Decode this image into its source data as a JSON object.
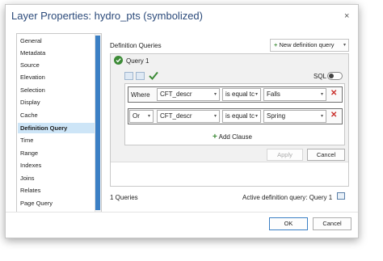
{
  "dialog": {
    "title": "Layer Properties: hydro_pts (symbolized)",
    "close_icon": "×"
  },
  "nav": {
    "items": [
      "General",
      "Metadata",
      "Source",
      "Elevation",
      "Selection",
      "Display",
      "Cache",
      "Definition Query",
      "Time",
      "Range",
      "Indexes",
      "Joins",
      "Relates",
      "Page Query"
    ],
    "selected": "Definition Query"
  },
  "main": {
    "heading": "Definition Queries",
    "new_query_label": "New definition query",
    "query_name": "Query 1",
    "sql_label": "SQL",
    "clauses": [
      {
        "connector": "Where",
        "field": "CFT_descr",
        "operator": "is equal tc",
        "value": "Falls"
      },
      {
        "connector": "Or",
        "field": "CFT_descr",
        "operator": "is equal tc",
        "value": "Spring"
      }
    ],
    "add_clause_label": "Add Clause",
    "apply_label": "Apply",
    "cancel_label": "Cancel",
    "queries_count": "1 Queries",
    "active_query": "Active definition query: Query 1"
  },
  "footer": {
    "ok_label": "OK",
    "cancel_label": "Cancel"
  },
  "colors": {
    "accent": "#3b7fc4",
    "selected_bg": "#cde5f7",
    "title": "#2b4a7a",
    "check": "#3d8b37",
    "remove": "#c9302c"
  }
}
